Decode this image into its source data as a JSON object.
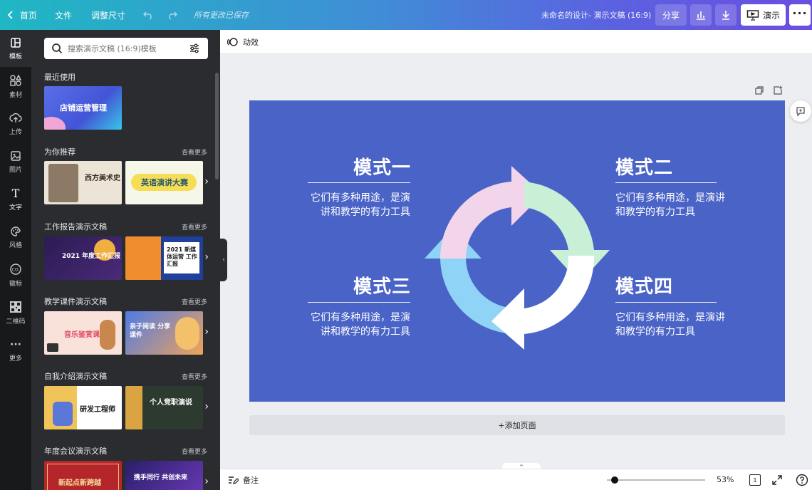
{
  "topbar": {
    "home": "首页",
    "file": "文件",
    "resize": "调整尺寸",
    "save_status": "所有更改已保存",
    "doc_title": "未命名的设计- 演示文稿 (16:9)",
    "share": "分享",
    "present": "演示"
  },
  "rail": {
    "templates": "模板",
    "elements": "素材",
    "upload": "上传",
    "photos": "图片",
    "text": "文字",
    "styles": "风格",
    "logos": "徽标",
    "qrcode": "二维码",
    "more": "更多"
  },
  "panel": {
    "search_placeholder": "搜索演示文稿 (16:9)模板",
    "recent": "最近使用",
    "recent_thumb": "店铺运营管理",
    "see_more": "查看更多",
    "sections": [
      {
        "title": "为你推荐",
        "t1": "西方美术史",
        "t2": "英语演讲大赛"
      },
      {
        "title": "工作报告演示文稿",
        "t1": "2021 年度工作汇报",
        "t2": "2021 新媒体运营 工作汇报"
      },
      {
        "title": "教学课件演示文稿",
        "t1": "音乐鉴赏课",
        "t2": "亲子阅读 分享课件"
      },
      {
        "title": "自我介绍演示文稿",
        "t1": "研发工程师",
        "t2": "个人竞职演说"
      },
      {
        "title": "年度会议演示文稿",
        "t1": "新起点新跨越",
        "t2": "携手同行 共创未来"
      }
    ]
  },
  "canvas": {
    "animate": "动效",
    "add_page": "+添加页面",
    "notes": "备注",
    "zoom": "53%",
    "page_num": "1"
  },
  "slide": {
    "modes": [
      {
        "title": "模式一",
        "desc1": "它们有多种用途，是演",
        "desc2": "讲和教学的有力工具"
      },
      {
        "title": "模式二",
        "desc1": "它们有多种用途，是演讲",
        "desc2": "和教学的有力工具"
      },
      {
        "title": "模式三",
        "desc1": "它们有多种用途，是演",
        "desc2": "讲和教学的有力工具"
      },
      {
        "title": "模式四",
        "desc1": "它们有多种用途，是演讲",
        "desc2": "和教学的有力工具"
      }
    ],
    "colors": {
      "background": "#4a63c6",
      "pink": "#f2d5ea",
      "green": "#c9efd6",
      "blue": "#8fd3f7",
      "white": "#ffffff"
    }
  }
}
